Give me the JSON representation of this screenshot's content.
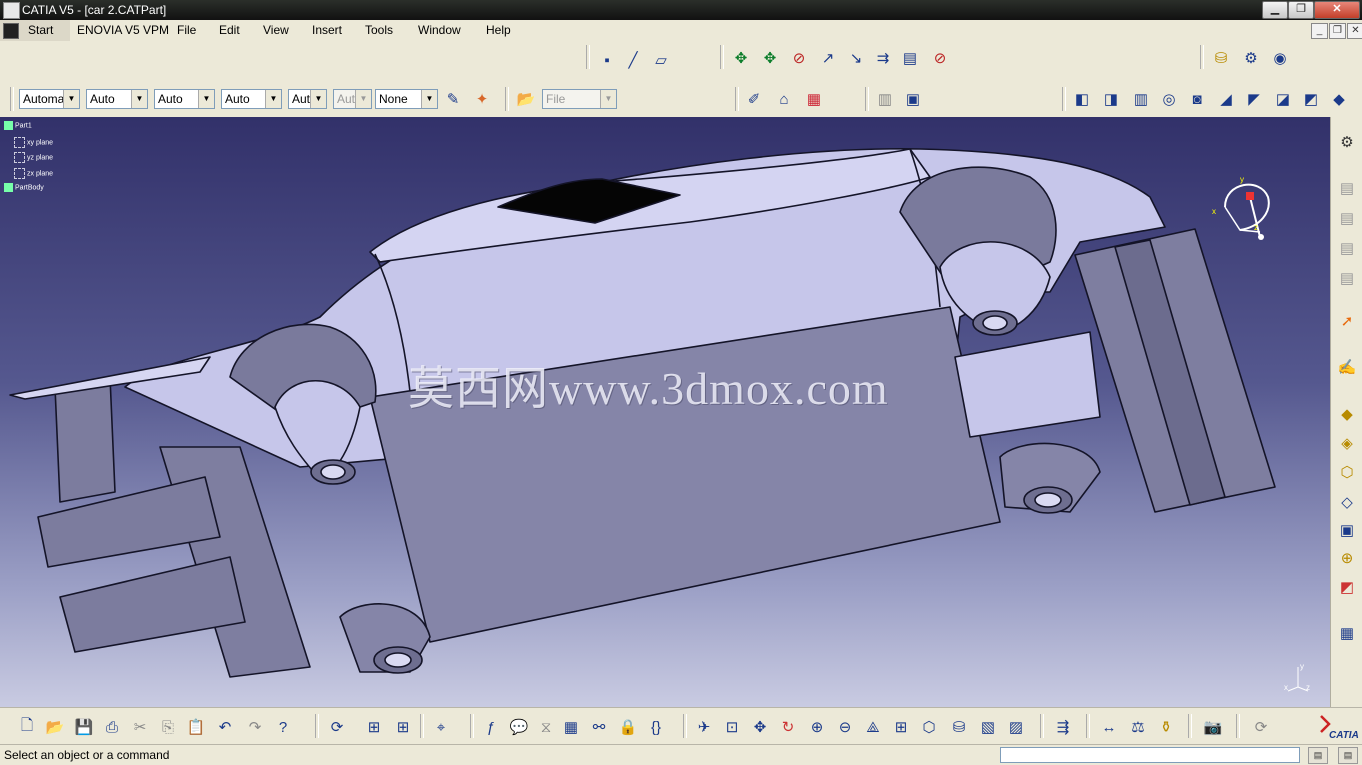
{
  "window": {
    "title": "CATIA V5 - [car 2.CATPart]",
    "min_label": "▁",
    "max_label": "❐",
    "close_label": "✕"
  },
  "menubar": {
    "start": "Start",
    "items": [
      "ENOVIA V5 VPM",
      "File",
      "Edit",
      "View",
      "Insert",
      "Tools",
      "Window",
      "Help"
    ],
    "mdi_min": "_",
    "mdi_restore": "❐",
    "mdi_close": "✕"
  },
  "toolbar": {
    "combos": [
      "Automa",
      "Auto",
      "Auto",
      "Auto",
      "Aut",
      "Aut",
      "None"
    ],
    "file_combo": "File"
  },
  "tree": {
    "items": [
      "Part1",
      "xy plane",
      "yz plane",
      "zx plane",
      "PartBody"
    ]
  },
  "viewport": {
    "watermark": "莫西网www.3dmox.com",
    "compass_labels": [
      "y",
      "x",
      "z"
    ],
    "axis_labels": [
      "y",
      "x",
      "z"
    ]
  },
  "status": {
    "message": "Select an object or a command"
  },
  "brand": {
    "logo_text": "CATIA"
  },
  "colors": {
    "viewport_top": "#32316a",
    "viewport_bottom": "#c9cbe2",
    "model_fill": "#c4c4e8",
    "model_dark": "#66668a",
    "accent": "#1b3a8a"
  }
}
